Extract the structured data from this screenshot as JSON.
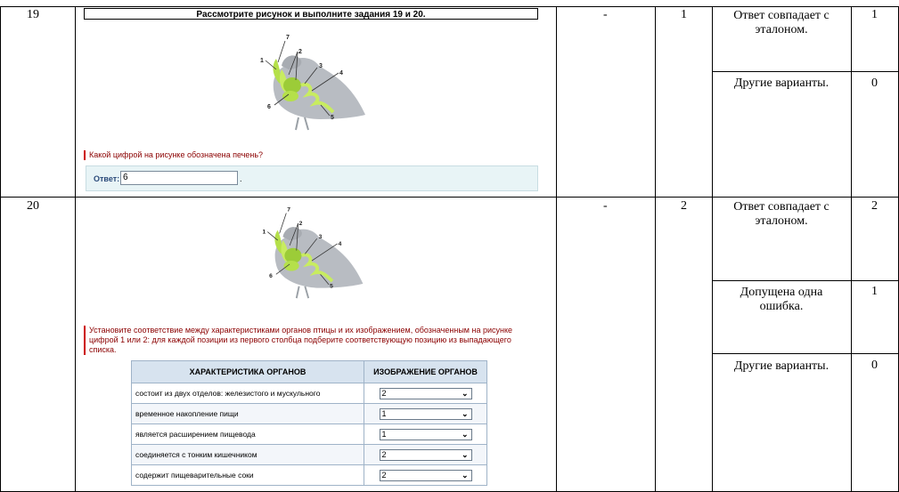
{
  "rows": [
    {
      "number": "19",
      "dash": "-",
      "max_score": "1",
      "criteria": [
        {
          "text": "Ответ совпадает с эталоном.",
          "score": "1"
        },
        {
          "text": "Другие варианты.",
          "score": "0"
        }
      ]
    },
    {
      "number": "20",
      "dash": "-",
      "max_score": "2",
      "criteria": [
        {
          "text": "Ответ совпадает с эталоном.",
          "score": "2"
        },
        {
          "text": "Допущена одна ошибка.",
          "score": "1"
        },
        {
          "text": "Другие варианты.",
          "score": "0"
        }
      ]
    }
  ],
  "task19": {
    "title": "Рассмотрите рисунок и выполните задания 19 и 20.",
    "question": "Какой цифрой на рисунке обозначена печень?",
    "answer_label": "Ответ:",
    "answer_value": "6"
  },
  "task20": {
    "instruction": "Установите соответствие между характеристиками органов птицы и их изображением, обозначенным на рисунке цифрой 1 или 2: для каждой позиции из первого столбца подберите соответствующую позицию из выпадающего списка.",
    "table_headers": [
      "ХАРАКТЕРИСТИКА ОРГАНОВ",
      "ИЗОБРАЖЕНИЕ ОРГАНОВ"
    ],
    "table_rows": [
      {
        "characteristic": "состоит из двух отделов: железистого и мускульного",
        "value": "2"
      },
      {
        "characteristic": "временное накопление пищи",
        "value": "1"
      },
      {
        "characteristic": "является расширением пищевода",
        "value": "1"
      },
      {
        "characteristic": "соединяется с тонким кишечником",
        "value": "2"
      },
      {
        "characteristic": "содержит пищеварительные соки",
        "value": "2"
      }
    ]
  },
  "figure_labels": [
    "7",
    "2",
    "1",
    "3",
    "4",
    "6",
    "5"
  ],
  "colors": {
    "question_red": "#8b0000",
    "answer_bg": "#e8f4f6",
    "organ_green": "#b5e04a",
    "bird_gray": "#b8bcc2"
  }
}
